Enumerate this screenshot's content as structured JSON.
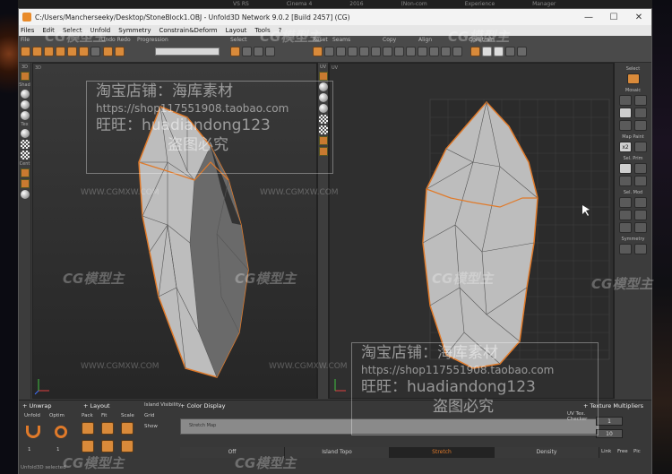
{
  "desktop": {
    "top_labels": [
      "VS RS",
      "Cinema 4",
      "2016",
      "(Non-com",
      "Experience",
      "Manager"
    ]
  },
  "window": {
    "title": "C:/Users/Mancherseeky/Desktop/StoneBlock1.OBJ - Unfold3D Network 9.0.2 [Build 2457] (CG)",
    "controls": {
      "minimize": "—",
      "maximize": "☐",
      "close": "✕"
    }
  },
  "menu": [
    "Files",
    "Edit",
    "Select",
    "Unfold",
    "Symmetry",
    "Constrain&Deform",
    "Layout",
    "Tools",
    "?"
  ],
  "toolbar": {
    "groups": {
      "file": "File",
      "undo_redo": "Undo Redo",
      "progression": "Progression",
      "select": "Select",
      "reset": "Reset",
      "seams": "Seams",
      "copy": "Copy",
      "align": "Align",
      "constrain": "Constrain"
    }
  },
  "left_tools": {
    "labels": [
      "3D",
      "Shad",
      "Tex",
      "Cent"
    ]
  },
  "viewports": {
    "left_label": "3D",
    "right_label": "UV",
    "uv_tools_label": "UV"
  },
  "right_panel": {
    "select": "Select",
    "mosaic": "Mosaic",
    "map_paint": "Map Paint",
    "sel_prim": "Sel. Prim",
    "sel_mod": "Sel. Mod",
    "symmetry": "Symmetry",
    "x2_label": "x2"
  },
  "bottom": {
    "unwrap": "+ Unwrap",
    "layout": "+ Layout",
    "unfold": "Unfold",
    "optim": "Optim",
    "pack": "Pack",
    "fit": "Fit",
    "scale": "Scale",
    "unwrap_values": [
      "1",
      "1"
    ],
    "color_display": "+ Color Display",
    "slider_label": "Stretch Map",
    "side_labels": [
      "Island Visibility",
      "Grid",
      "Show"
    ],
    "tabs": [
      "Off",
      "Island Topo",
      "Stretch",
      "Density"
    ],
    "active_tab": "Stretch",
    "texture_multipliers": "+ Texture Multipliers",
    "tm_values": [
      "1",
      "10"
    ],
    "tm_labels": [
      "Link",
      "Free",
      "Pic"
    ],
    "uv_tex_label": "UV Tex. Checker",
    "bottom_status": "Unfold3D selected"
  },
  "watermarks": {
    "shop_line1": "淘宝店铺：海库素材",
    "shop_line2": "https://shop117551908.taobao.com",
    "shop_line3": "旺旺：huadiandong123",
    "shop_line4": "盗图必究",
    "logo": "CG模型主",
    "url": "WWW.CGMXW.COM"
  },
  "colors": {
    "accent": "#e07a2a",
    "mesh": "#bdbdbd",
    "seam": "#e07a2a"
  }
}
